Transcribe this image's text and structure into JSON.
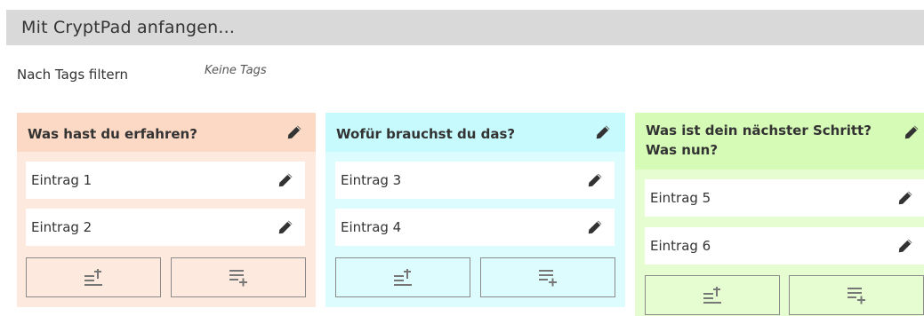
{
  "header": {
    "title": "Mit CryptPad anfangen..."
  },
  "filter": {
    "label": "Nach Tags filtern",
    "value": "Keine Tags"
  },
  "colors": {
    "board1_header": "#fcd9c4",
    "board1_body": "#fde9de",
    "board2_header": "#c7fafc",
    "board2_body": "#ddfcfd",
    "board3_header": "#d6fbb6",
    "board3_body": "#e6fdd2",
    "header_bar": "#d9d9d9"
  },
  "boards": [
    {
      "title": "Was hast du erfahren?",
      "items": [
        {
          "label": "Eintrag 1"
        },
        {
          "label": "Eintrag 2"
        }
      ],
      "buttons": {
        "add_top": "add-item-top-icon",
        "add_bottom": "add-item-bottom-icon"
      }
    },
    {
      "title": "Wofür brauchst du das?",
      "items": [
        {
          "label": "Eintrag 3"
        },
        {
          "label": "Eintrag 4"
        }
      ],
      "buttons": {
        "add_top": "add-item-top-icon",
        "add_bottom": "add-item-bottom-icon"
      }
    },
    {
      "title": "Was ist dein nächster Schritt? Was nun?",
      "items": [
        {
          "label": "Eintrag 5"
        },
        {
          "label": "Eintrag 6"
        }
      ],
      "buttons": {
        "add_top": "add-item-top-icon",
        "add_bottom": "add-item-bottom-icon"
      }
    }
  ]
}
